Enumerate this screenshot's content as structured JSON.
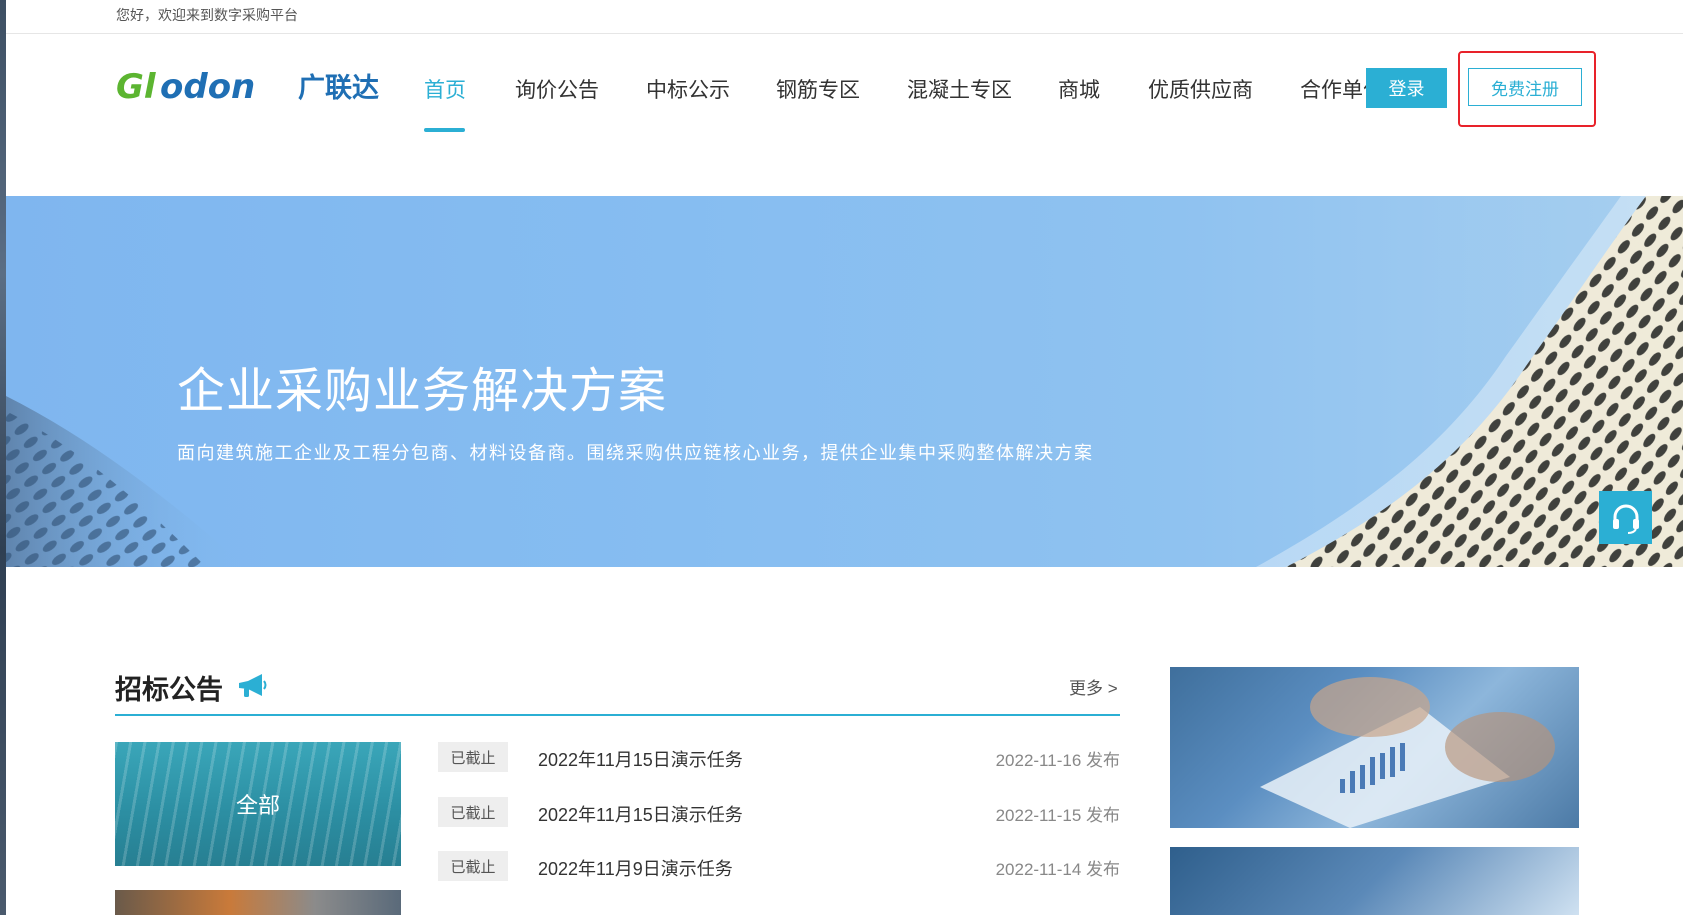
{
  "topbar": {
    "welcome": "您好，欢迎来到数字采购平台"
  },
  "header": {
    "logo_text": "Glodon广联达",
    "nav": [
      {
        "label": "首页",
        "active": true
      },
      {
        "label": "询价公告",
        "active": false
      },
      {
        "label": "中标公示",
        "active": false
      },
      {
        "label": "钢筋专区",
        "active": false
      },
      {
        "label": "混凝土专区",
        "active": false
      },
      {
        "label": "商城",
        "active": false
      },
      {
        "label": "优质供应商",
        "active": false
      },
      {
        "label": "合作单位",
        "active": false
      }
    ],
    "login_label": "登录",
    "register_label": "免费注册"
  },
  "banner": {
    "title": "企业采购业务解决方案",
    "subtitle": "面向建筑施工企业及工程分包商、材料设备商。围绕采购供应链核心业务，提供企业集中采购整体解决方案"
  },
  "tender": {
    "title": "招标公告",
    "more": "更多 >",
    "category_all": "全部",
    "notices": [
      {
        "status": "已截止",
        "title": "2022年11月15日演示任务",
        "date": "2022-11-16 发布"
      },
      {
        "status": "已截止",
        "title": "2022年11月15日演示任务",
        "date": "2022-11-15 发布"
      },
      {
        "status": "已截止",
        "title": "2022年11月9日演示任务",
        "date": "2022-11-14 发布"
      }
    ]
  },
  "colors": {
    "accent": "#2bafd4",
    "highlight": "#e8222a",
    "logo_green": "#5cb531",
    "logo_blue": "#1f6fb4"
  },
  "icons": {
    "support": "headset-icon",
    "megaphone": "megaphone-icon"
  }
}
